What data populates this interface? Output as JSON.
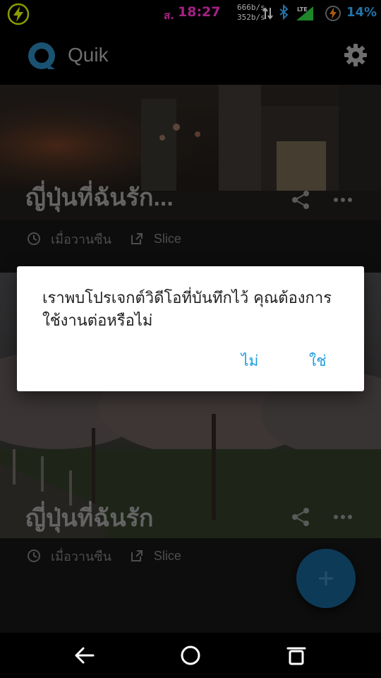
{
  "status_bar": {
    "day": "ส.",
    "time": "18:27",
    "speed_down": "666b/s",
    "speed_up": "352b/s",
    "network": "LTE",
    "battery": "14%",
    "colors": {
      "time": "#ff33cc",
      "battery": "#3ab0ff",
      "bolt": "#d8f000"
    }
  },
  "app_bar": {
    "title": "Quik"
  },
  "projects": [
    {
      "title": "ญี่ปุ่นที่ฉันรัก...",
      "date": "เมื่อวานซืน",
      "theme": "Slice"
    },
    {
      "title": "ญี่ปุ่นที่ฉันรัก",
      "date": "เมื่อวานซืน",
      "theme": "Slice"
    }
  ],
  "dialog": {
    "message": "เราพบโปรเจกต์วิดีโอที่บันทึกไว้ คุณต้องการใช้งานต่อหรือไม่",
    "negative": "ไม่",
    "positive": "ใช่"
  },
  "fab": {
    "symbol": "+"
  },
  "icons": [
    "bolt-icon",
    "bluetooth-icon",
    "data-arrows-icon",
    "lte-signal-icon",
    "battery-saver-icon",
    "quik-logo",
    "gear-icon",
    "share-icon",
    "more-icon",
    "clock-icon",
    "edit-icon",
    "back-icon",
    "home-icon",
    "recents-icon"
  ],
  "accent": "#1e9be0"
}
